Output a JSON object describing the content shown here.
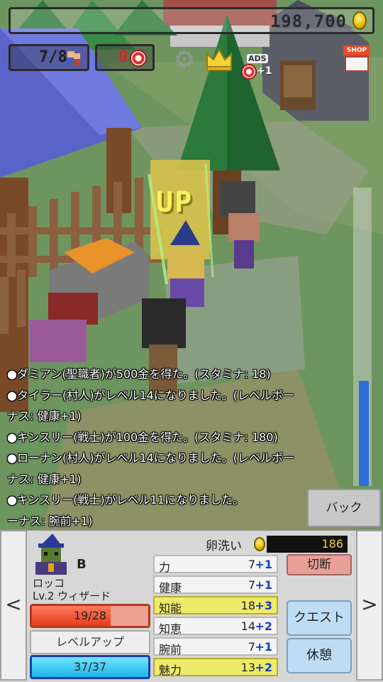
{
  "hud": {
    "gold": "198,700",
    "villagers": "7/8",
    "tickets": "0",
    "ads_label": "ADS",
    "ads_bonus": "+1",
    "shop_label": "SHOP"
  },
  "scene": {
    "up_text": "UP"
  },
  "log": [
    "●ダミアン(聖職者)が500金を得た。(スタミナ: 18)",
    "●タイラー(村人)がレベル14になりました。(レベルボー",
    "ナス: 健康+1)",
    "●キンスリー(戦士)が100金を得た。(スタミナ: 180)",
    "●ローナン(村人)がレベル14になりました。(レベルボー",
    "ナス: 健康+1)",
    "●キンスリー(戦士)がレベル11になりました。",
    "ーナス: 腕前+1)"
  ],
  "back_button": "バック",
  "hero": {
    "rank": "B",
    "name": "ロッコ",
    "class": "Lv.2 ウィザード",
    "hp_text": "19/28",
    "hp_ratio": 0.679,
    "mp_text": "37/37",
    "mp_ratio": 1.0,
    "levelup_label": "レベルアップ",
    "price_label": "卵洗い",
    "price_value": "186",
    "stats": [
      {
        "name": "力",
        "value": "7",
        "bonus": "+1",
        "highlight": false
      },
      {
        "name": "健康",
        "value": "7",
        "bonus": "+1",
        "highlight": false
      },
      {
        "name": "知能",
        "value": "18",
        "bonus": "+3",
        "highlight": true
      },
      {
        "name": "知恵",
        "value": "14",
        "bonus": "+2",
        "highlight": false
      },
      {
        "name": "腕前",
        "value": "7",
        "bonus": "+1",
        "highlight": false
      },
      {
        "name": "魅力",
        "value": "13",
        "bonus": "+2",
        "highlight": true
      }
    ]
  },
  "buttons": {
    "cut": "切断",
    "quest": "クエスト",
    "rest": "休憩",
    "prev": "<",
    "next": ">"
  },
  "colors": {
    "hp": "#e23e1c",
    "mp": "#1cb4e8",
    "stat_bonus": "#1a3fc0",
    "highlight": "#eeea6a"
  }
}
